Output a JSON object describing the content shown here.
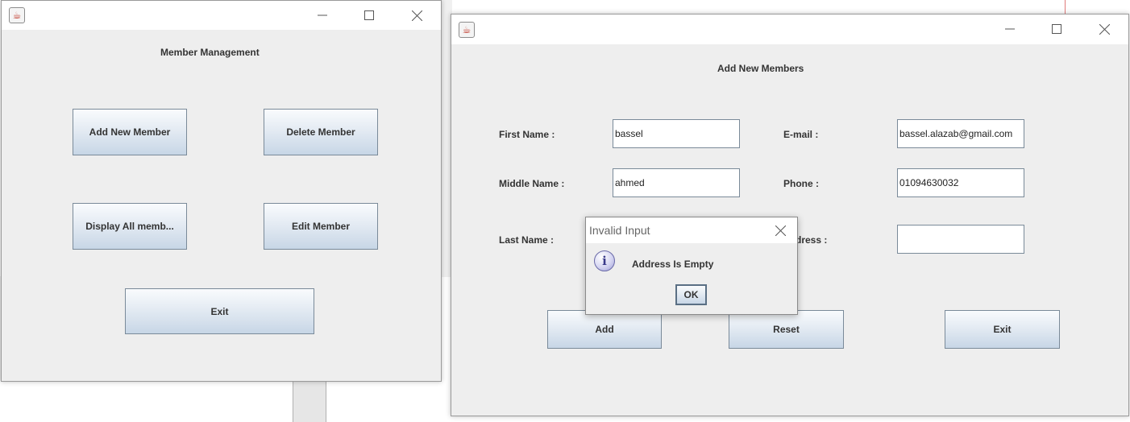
{
  "member_management": {
    "title": "Member Management",
    "buttons": {
      "add_new_member": "Add New Member",
      "delete_member": "Delete Member",
      "display_all_members": "Display All memb...",
      "edit_member": "Edit Member",
      "exit": "Exit"
    }
  },
  "add_members": {
    "title": "Add New Members",
    "labels": {
      "first_name": "First Name :",
      "middle_name": "Middle Name :",
      "last_name": "Last Name :",
      "email": "E-mail :",
      "phone": "Phone :",
      "address_partial": "dress :"
    },
    "values": {
      "first_name": "bassel",
      "middle_name": "ahmed",
      "email": "bassel.alazab@gmail.com",
      "phone": "01094630032",
      "address": ""
    },
    "buttons": {
      "add": "Add",
      "reset": "Reset",
      "exit": "Exit"
    }
  },
  "dialog": {
    "title": "Invalid Input",
    "message": "Address Is Empty",
    "ok": "OK"
  },
  "icons": {
    "window_icon": "java-icon",
    "info": "information-icon"
  },
  "colors": {
    "window_bg": "#eeeeee",
    "titlebar_bg": "#ffffff",
    "button_border": "#7a8a99"
  }
}
